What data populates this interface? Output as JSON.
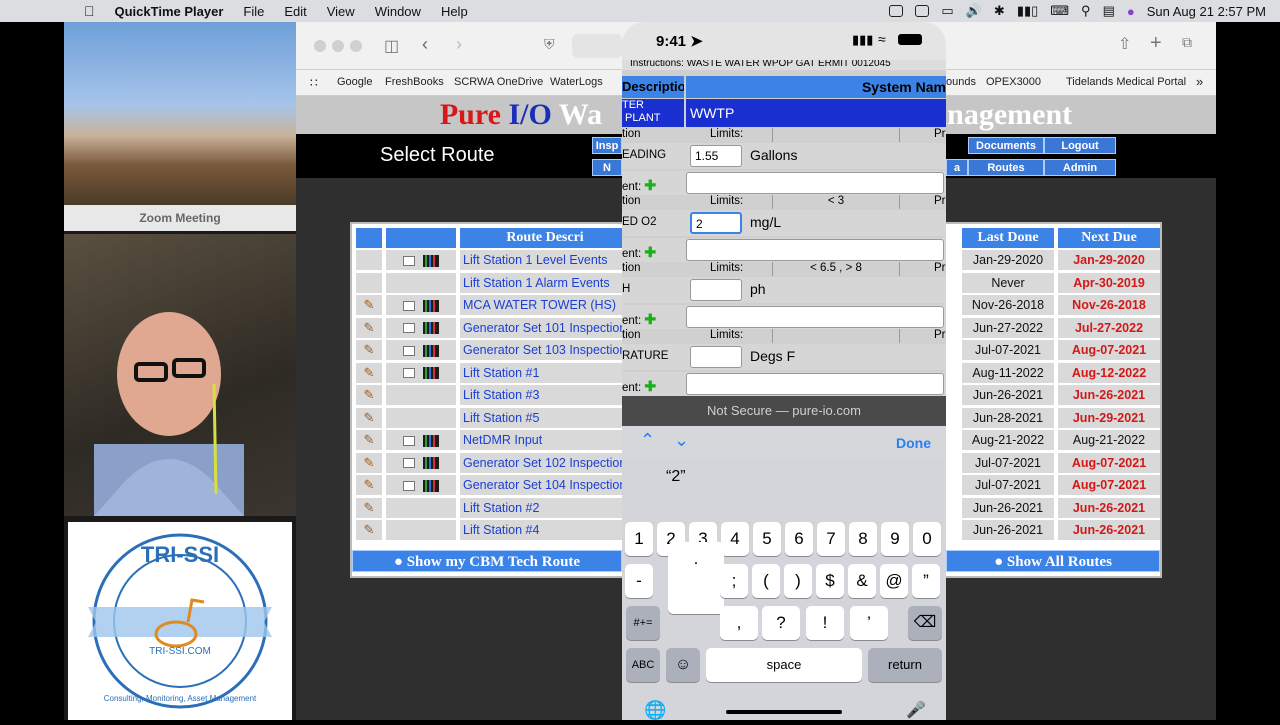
{
  "menubar": {
    "app_name": "QuickTime Player",
    "menus": [
      "File",
      "Edit",
      "View",
      "Window",
      "Help"
    ],
    "datetime": "Sun Aug 21  2:57 PM"
  },
  "zoom": {
    "label": "Zoom Meeting",
    "logo_title": "TRI-SSI",
    "logo_url": "TRI-SSI.COM",
    "logo_tagline": "Consulting, Monitoring, Asset Management"
  },
  "safari": {
    "favorites": [
      "Google",
      "FreshBooks",
      "SCRWA OneDrive",
      "WaterLogs",
      "ounds",
      "OPEX3000",
      "Tidelands Medical Portal"
    ],
    "brand": {
      "w1": "Pure",
      "w2": "I/O",
      "w3": "Wa",
      "w4": "anagement"
    },
    "select_route": "Select Route",
    "nav_buttons": [
      "Insp",
      "Documents",
      "Logout",
      "N",
      "a",
      "Routes",
      "Admin"
    ],
    "table_headers": {
      "route_description": "Route Descri",
      "last_done": "Last Done",
      "next_due": "Next Due"
    },
    "rows": [
      {
        "name": "Lift Station 1 Level Events",
        "last": "Jan-29-2020",
        "due": "Jan-29-2020",
        "overdue": true
      },
      {
        "name": "Lift Station 1 Alarm Events",
        "last": "Never",
        "due": "Apr-30-2019",
        "overdue": true
      },
      {
        "name": "MCA WATER TOWER (HS)",
        "last": "Nov-26-2018",
        "due": "Nov-26-2018",
        "overdue": true
      },
      {
        "name": "Generator Set 101 Inspection",
        "last": "Jun-27-2022",
        "due": "Jul-27-2022",
        "overdue": true
      },
      {
        "name": "Generator Set 103 Inspection",
        "last": "Jul-07-2021",
        "due": "Aug-07-2021",
        "overdue": true
      },
      {
        "name": "Lift Station #1",
        "last": "Aug-11-2022",
        "due": "Aug-12-2022",
        "overdue": true
      },
      {
        "name": "Lift Station #3",
        "last": "Jun-26-2021",
        "due": "Jun-26-2021",
        "overdue": true
      },
      {
        "name": "Lift Station #5",
        "last": "Jun-28-2021",
        "due": "Jun-29-2021",
        "overdue": true
      },
      {
        "name": "NetDMR Input",
        "last": "Aug-21-2022",
        "due": "Aug-21-2022",
        "overdue": false
      },
      {
        "name": "Generator Set 102 Inspection",
        "last": "Jul-07-2021",
        "due": "Aug-07-2021",
        "overdue": true
      },
      {
        "name": "Generator Set 104 Inspection",
        "last": "Jul-07-2021",
        "due": "Aug-07-2021",
        "overdue": true
      },
      {
        "name": "Lift Station #2",
        "last": "Jun-26-2021",
        "due": "Jun-26-2021",
        "overdue": true
      },
      {
        "name": "Lift Station #4",
        "last": "Jun-26-2021",
        "due": "Jun-26-2021",
        "overdue": true
      }
    ],
    "show_cbm": "Show my CBM Tech Route",
    "show_all": "Show All Routes"
  },
  "phone": {
    "time": "9:41",
    "instructions": "Instructions:  WASTE WATER WPOP GAT ERMIT 0012045",
    "col_description": "Description",
    "col_system": "System Nam",
    "system_left": "TER\n PLANT",
    "system_value": "WWTP",
    "rows": [
      {
        "limits_label": "tion",
        "limits": "Limits:",
        "limit_val": "",
        "pr": "Pr",
        "label": "EADING",
        "value": "1.55",
        "unit": "Gallons",
        "comment": "ent:"
      },
      {
        "limits_label": "tion",
        "limits": "Limits:",
        "limit_val": "< 3",
        "pr": "Pr",
        "label": "ED O2",
        "value": "2",
        "unit": "mg/L",
        "comment": "ent:"
      },
      {
        "limits_label": "tion",
        "limits": "Limits:",
        "limit_val": "< 6.5 , > 8",
        "pr": "Pr",
        "label": "H",
        "value": "",
        "unit": "ph",
        "comment": "ent:"
      },
      {
        "limits_label": "tion",
        "limits": "Limits:",
        "limit_val": "",
        "pr": "Pr",
        "label": "RATURE",
        "value": "",
        "unit": "Degs F",
        "comment": "ent:"
      }
    ],
    "url": "Not Secure — pure-io.com",
    "done": "Done",
    "suggestion": "“2”",
    "keys_row1": [
      "1",
      "2",
      "3",
      "4",
      "5",
      "6",
      "7",
      "8",
      "9",
      "0"
    ],
    "keys_row2": [
      "-",
      ".",
      ";",
      "(",
      ")",
      "$",
      "&",
      "@",
      "”"
    ],
    "keys_row3": [
      ",",
      "?",
      "!",
      "’"
    ],
    "key_symbols": "#+=",
    "key_abc": "ABC",
    "key_space": "space",
    "key_return": "return"
  }
}
